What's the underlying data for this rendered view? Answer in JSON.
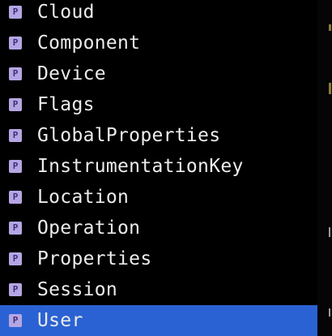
{
  "badge_letter": "P",
  "items": [
    {
      "label": "Cloud",
      "selected": false
    },
    {
      "label": "Component",
      "selected": false
    },
    {
      "label": "Device",
      "selected": false
    },
    {
      "label": "Flags",
      "selected": false
    },
    {
      "label": "GlobalProperties",
      "selected": false
    },
    {
      "label": "InstrumentationKey",
      "selected": false
    },
    {
      "label": "Location",
      "selected": false
    },
    {
      "label": "Operation",
      "selected": false
    },
    {
      "label": "Properties",
      "selected": false
    },
    {
      "label": "Session",
      "selected": false
    },
    {
      "label": "User",
      "selected": true
    }
  ],
  "colors": {
    "background": "#000000",
    "selection": "#2b62d3",
    "badge": "#b5a6e3",
    "badge_text": "#3e2e73",
    "text": "#ececec"
  },
  "icons": {
    "badge": "property-icon"
  }
}
